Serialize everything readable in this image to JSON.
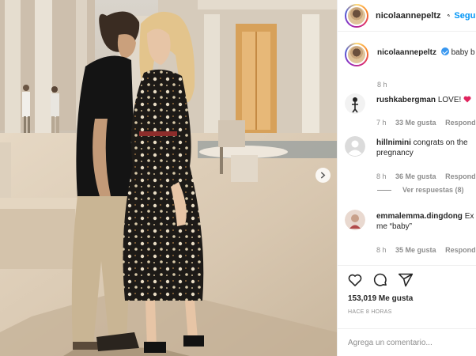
{
  "post": {
    "username": "nicolaanne",
    "username_tail": "peltz",
    "follow_label": "Seguir",
    "separator": "•"
  },
  "caption": {
    "username": "nicolaannepeltz",
    "text": "baby b",
    "time": "8 h"
  },
  "comments": [
    {
      "username": "rushkabergman",
      "text": "LOVE!",
      "time": "7 h",
      "likes": "33 Me gusta",
      "reply": "Responder"
    },
    {
      "username": "hillnimini",
      "text": "congrats on the pregnancy",
      "time": "8 h",
      "likes": "36 Me gusta",
      "reply": "Responder"
    },
    {
      "username": "emmalemma.dingdong",
      "text": "Ex",
      "text2": "me “baby”",
      "time": "8 h",
      "likes": "35 Me gusta",
      "reply": "Responder"
    }
  ],
  "view_replies": "Ver respuestas (8)",
  "likes_count": "153,019 Me gusta",
  "time_ago": "HACE 8 HORAS",
  "comment_placeholder": "Agrega un comentario...",
  "icons": [
    "heart-icon",
    "comment-icon",
    "share-icon",
    "chevron-right-icon",
    "verified-badge-icon",
    "heart-emoji-icon"
  ],
  "colors": {
    "link": "#0095f6",
    "verified": "#3897f0",
    "muted": "#8e8e8e"
  }
}
